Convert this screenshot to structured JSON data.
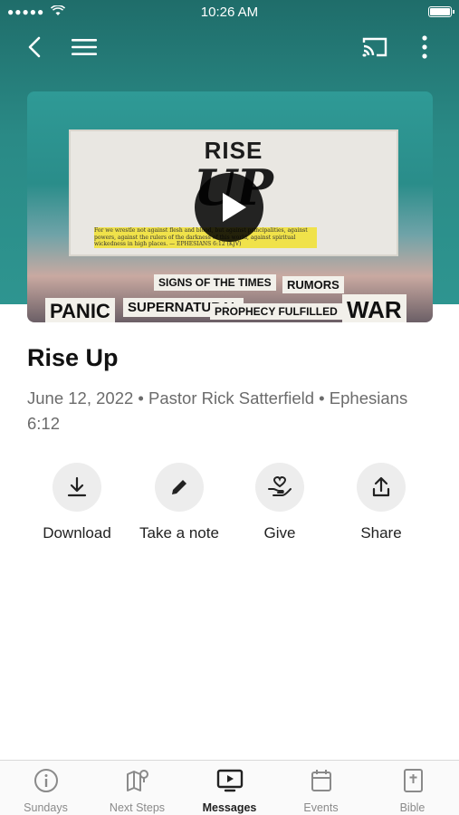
{
  "status_bar": {
    "time": "10:26 AM",
    "signal": "●●●●●"
  },
  "nav": {
    "back_icon": "chevron-left-icon",
    "menu_icon": "hamburger-icon",
    "cast_icon": "cast-icon",
    "more_icon": "more-vertical-icon"
  },
  "hero": {
    "artwork_title_1": "RISE",
    "artwork_title_2": "UP",
    "verse": "For we wrestle not against flesh and blood, but against principalities, against powers, against the rulers of the darkness of this world, against spiritual wickedness in high places. — EPHESIANS 6:12 (KJV)",
    "clippings": [
      "SIGNS OF THE TIMES",
      "RUMORS",
      "PANIC",
      "SUPERNATURAL",
      "PROPHECY FULFILLED",
      "WAR"
    ]
  },
  "message": {
    "title": "Rise Up",
    "meta": "June 12, 2022 • Pastor Rick Satterfield • Ephesians 6:12"
  },
  "actions": [
    {
      "label": "Download",
      "icon": "download-icon"
    },
    {
      "label": "Take a note",
      "icon": "pencil-icon"
    },
    {
      "label": "Give",
      "icon": "give-heart-hand-icon"
    },
    {
      "label": "Share",
      "icon": "share-icon"
    }
  ],
  "tabs": [
    {
      "label": "Sundays",
      "icon": "info-circle-icon",
      "active": false
    },
    {
      "label": "Next Steps",
      "icon": "map-pin-icon",
      "active": false
    },
    {
      "label": "Messages",
      "icon": "play-screen-icon",
      "active": true
    },
    {
      "label": "Events",
      "icon": "calendar-icon",
      "active": false
    },
    {
      "label": "Bible",
      "icon": "bible-icon",
      "active": false
    }
  ],
  "colors": {
    "header": "#2a8a86",
    "active_tab": "#222222",
    "inactive_tab": "#8a8a8a"
  }
}
